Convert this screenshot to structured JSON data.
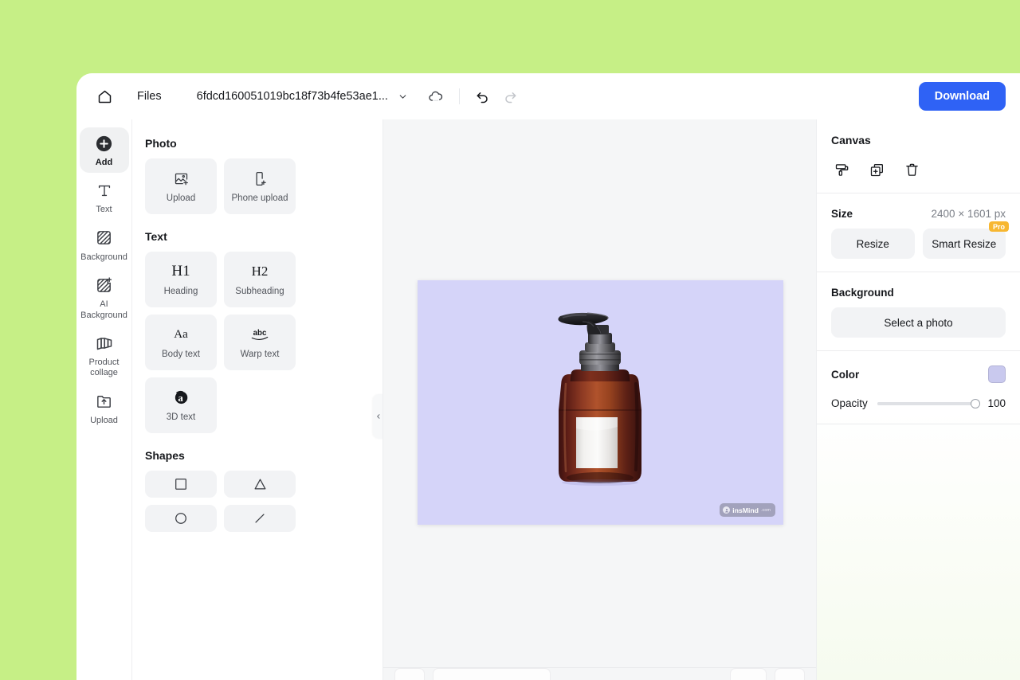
{
  "theme": {
    "frame_bg": "#c6ef86",
    "accent_blue": "#2f62f5",
    "pro_badge_bg": "#f7b731",
    "canvas_bg": "#d5d4f9",
    "swatch_color": "#c9c9ee",
    "workspace_bg": "#f5f6f7"
  },
  "header": {
    "home_icon": "home-icon",
    "files_label": "Files",
    "document_name": "6fdcd160051019bc18f73b4fe53ae1...",
    "chevron_icon": "chevron-down-icon",
    "cloud_icon": "cloud-sync-icon",
    "undo_icon": "undo-icon",
    "redo_icon": "redo-icon",
    "download_label": "Download"
  },
  "left_rail": {
    "items": [
      {
        "label": "Add",
        "icon": "plus-circle-icon",
        "active": true
      },
      {
        "label": "Text",
        "icon": "text-t-icon",
        "active": false
      },
      {
        "label": "Background",
        "icon": "hatch-square-icon",
        "active": false
      },
      {
        "label": "AI Background",
        "icon": "hatch-sparkle-icon",
        "active": false
      },
      {
        "label": "Product collage",
        "icon": "collage-icon",
        "active": false
      },
      {
        "label": "Upload",
        "icon": "upload-folder-icon",
        "active": false
      }
    ]
  },
  "panel": {
    "sections": [
      {
        "title": "Photo",
        "tiles": [
          {
            "label": "Upload",
            "glyph": "image-plus-icon",
            "kind": "icon"
          },
          {
            "label": "Phone upload",
            "glyph": "phone-plus-icon",
            "kind": "icon"
          }
        ]
      },
      {
        "title": "Text",
        "tiles": [
          {
            "label": "Heading",
            "glyph": "H1",
            "kind": "serif"
          },
          {
            "label": "Subheading",
            "glyph": "H2",
            "kind": "serif"
          },
          {
            "label": "Body text",
            "glyph": "Aa",
            "kind": "serif"
          },
          {
            "label": "Warp text",
            "glyph": "abc",
            "kind": "warp"
          },
          {
            "label": "3D text",
            "glyph": "a",
            "kind": "3d"
          }
        ]
      },
      {
        "title": "Shapes",
        "tiles": [
          {
            "label": "",
            "glyph": "square-shape-icon",
            "kind": "shape"
          },
          {
            "label": "",
            "glyph": "triangle-shape-icon",
            "kind": "shape"
          },
          {
            "label": "",
            "glyph": "circle-shape-icon",
            "kind": "shape"
          },
          {
            "label": "",
            "glyph": "line-shape-icon",
            "kind": "shape"
          }
        ]
      }
    ],
    "collapse_icon": "chevron-left-icon"
  },
  "canvas": {
    "artboard_bg": "#d5d4f9",
    "product_alt": "amber pump bottle with blank white label",
    "watermark_text": "insMind",
    "watermark_tld": ".com"
  },
  "right_panel": {
    "title": "Canvas",
    "actions": [
      {
        "name": "paint-roller-icon"
      },
      {
        "name": "duplicate-plus-icon"
      },
      {
        "name": "trash-icon"
      }
    ],
    "size": {
      "label": "Size",
      "value": "2400 × 1601 px",
      "resize_label": "Resize",
      "smart_resize_label": "Smart Resize",
      "pro_badge": "Pro"
    },
    "background": {
      "label": "Background",
      "select_photo_label": "Select a photo"
    },
    "color": {
      "label": "Color",
      "swatch": "#c9c9ee"
    },
    "opacity": {
      "label": "Opacity",
      "value": "100",
      "percent": 100
    }
  }
}
